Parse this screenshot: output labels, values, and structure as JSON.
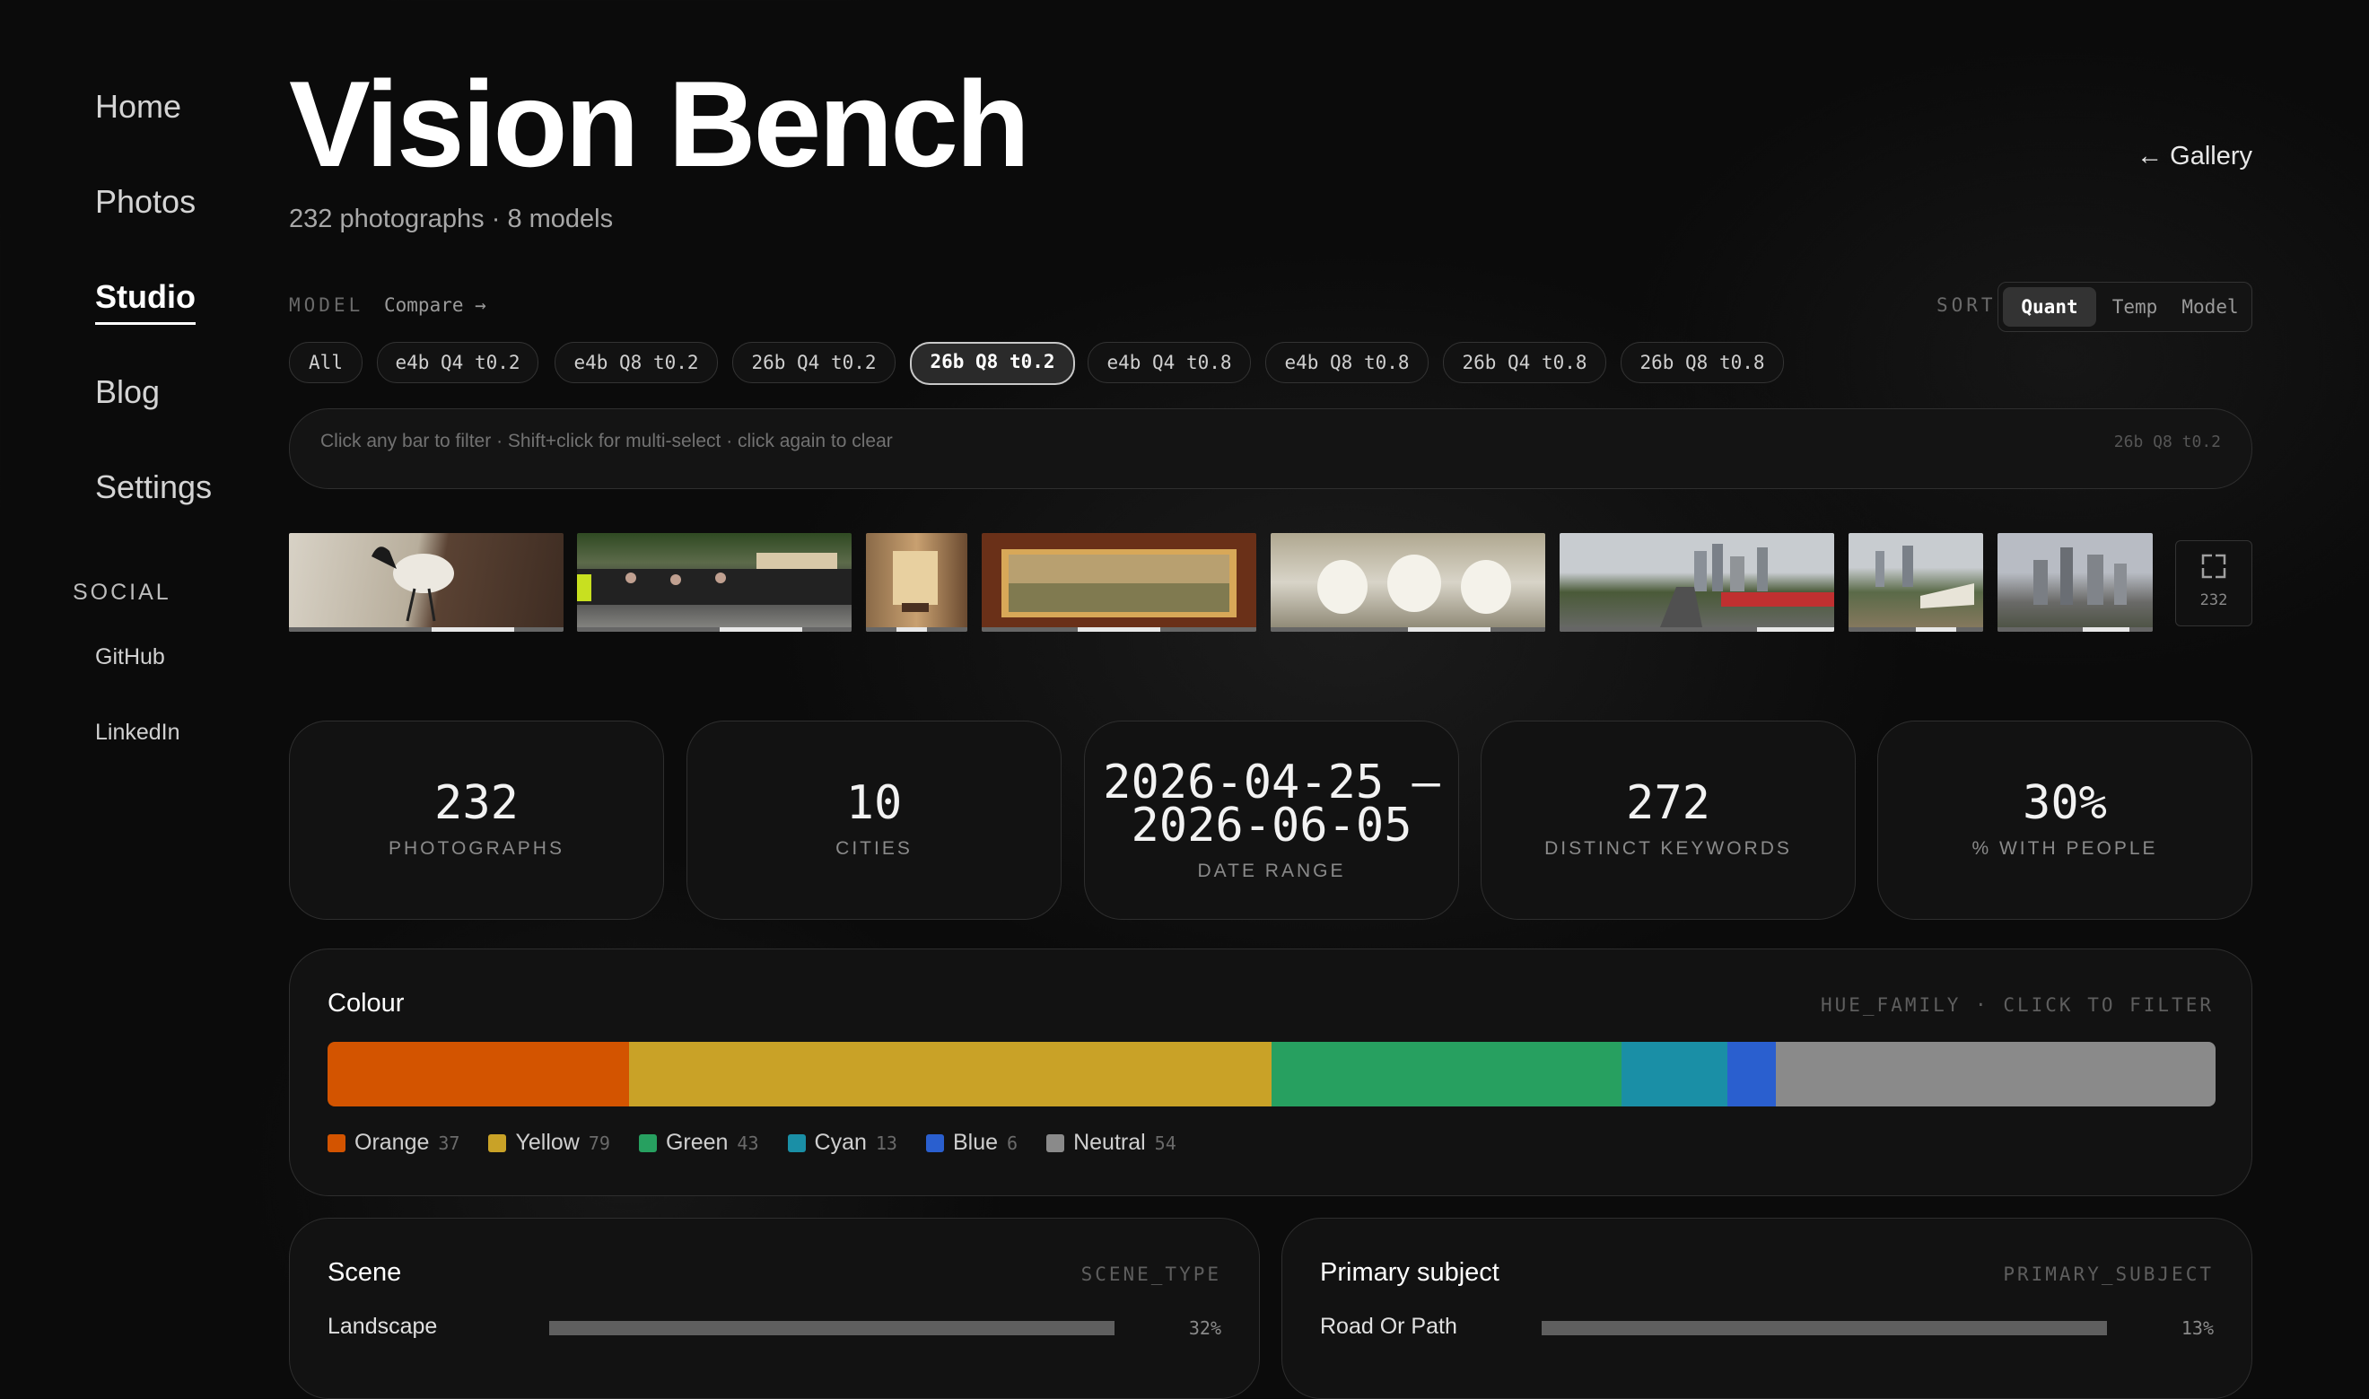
{
  "sidebar": {
    "nav": [
      "Home",
      "Photos",
      "Studio",
      "Blog",
      "Settings"
    ],
    "active": "Studio",
    "social_title": "SOCIAL",
    "social_links": [
      "GitHub",
      "LinkedIn"
    ]
  },
  "header": {
    "title": "Vision Bench",
    "subtitle": "232 photographs · 8 models",
    "gallery_link": "← Gallery"
  },
  "model_filter": {
    "label": "MODEL",
    "compare": "Compare →",
    "chips": [
      "All",
      "e4b Q4 t0.2",
      "e4b Q8 t0.2",
      "26b Q4 t0.2",
      "26b Q8 t0.2",
      "e4b Q4 t0.8",
      "e4b Q8 t0.8",
      "26b Q4 t0.8",
      "26b Q8 t0.8"
    ],
    "selected": "26b Q8 t0.2"
  },
  "sort": {
    "label": "SORT",
    "options": [
      "Quant",
      "Temp",
      "Model"
    ],
    "selected": "Quant"
  },
  "hint": {
    "text": "Click any bar to filter · Shift+click for multi-select · click again to clear",
    "active_model": "26b Q8 t0.2"
  },
  "thumbnails": {
    "count_label": "232",
    "items": [
      {
        "name": "bird-on-pavement",
        "progress": 0.52
      },
      {
        "name": "crowd-street",
        "progress": 0.52
      },
      {
        "name": "interior-room",
        "progress": 0.3
      },
      {
        "name": "framed-painting",
        "progress": 0.35
      },
      {
        "name": "fountain",
        "progress": 0.5
      },
      {
        "name": "city-highway",
        "progress": 0.72
      },
      {
        "name": "harbour-city",
        "progress": 0.5
      },
      {
        "name": "skyline",
        "progress": 0.55
      }
    ]
  },
  "stats": [
    {
      "value": "232",
      "label": "PHOTOGRAPHS"
    },
    {
      "value": "10",
      "label": "CITIES"
    },
    {
      "value": "2026-04-25 –\n2026-06-05",
      "line1": "2026-04-25 –",
      "line2": "2026-06-05",
      "label": "DATE RANGE"
    },
    {
      "value": "272",
      "label": "DISTINCT KEYWORDS"
    },
    {
      "value": "30%",
      "label": "% WITH PEOPLE"
    }
  ],
  "colour": {
    "title": "Colour",
    "tag": "HUE_FAMILY · CLICK TO FILTER",
    "segments": [
      {
        "name": "Orange",
        "count": "37",
        "color": "#d35400"
      },
      {
        "name": "Yellow",
        "count": "79",
        "color": "#c9a227"
      },
      {
        "name": "Green",
        "count": "43",
        "color": "#27a060"
      },
      {
        "name": "Cyan",
        "count": "13",
        "color": "#1a8fa6"
      },
      {
        "name": "Blue",
        "count": "6",
        "color": "#2a5fcf"
      },
      {
        "name": "Neutral",
        "count": "54",
        "color": "#8a8a8a"
      }
    ]
  },
  "scene": {
    "title": "Scene",
    "tag": "SCENE_TYPE",
    "rows": [
      {
        "label": "Landscape",
        "pct": "32%",
        "value": 32
      }
    ]
  },
  "primary_subject": {
    "title": "Primary subject",
    "tag": "PRIMARY_SUBJECT",
    "rows": [
      {
        "label": "Road Or Path",
        "pct": "13%",
        "value": 13
      }
    ]
  }
}
